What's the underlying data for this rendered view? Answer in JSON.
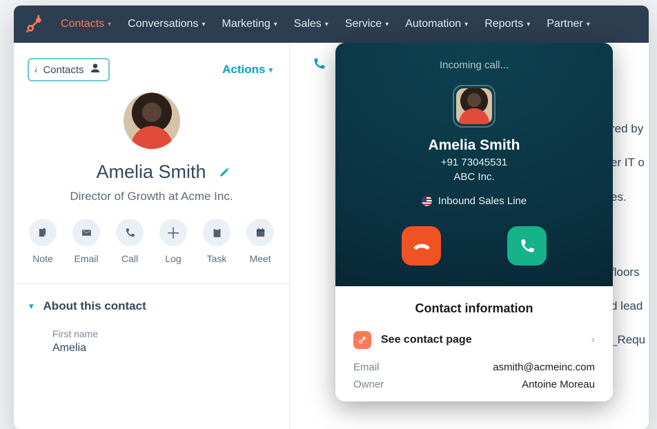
{
  "nav": {
    "items": [
      {
        "label": "Contacts",
        "active": true
      },
      {
        "label": "Conversations"
      },
      {
        "label": "Marketing"
      },
      {
        "label": "Sales"
      },
      {
        "label": "Service"
      },
      {
        "label": "Automation"
      },
      {
        "label": "Reports"
      },
      {
        "label": "Partner"
      }
    ]
  },
  "sidebar": {
    "back_label": "Contacts",
    "actions_label": "Actions",
    "contact_name": "Amelia Smith",
    "contact_title": "Director of Growth at Acme Inc.",
    "actions": [
      {
        "key": "note",
        "label": "Note"
      },
      {
        "key": "email",
        "label": "Email"
      },
      {
        "key": "call",
        "label": "Call"
      },
      {
        "key": "log",
        "label": "Log"
      },
      {
        "key": "task",
        "label": "Task"
      },
      {
        "key": "meet",
        "label": "Meet"
      }
    ],
    "section_title": "About this contact",
    "first_name_label": "First name",
    "first_name_value": "Amelia"
  },
  "call": {
    "status": "Incoming call...",
    "name": "Amelia Smith",
    "number": "+91 73045531",
    "company": "ABC Inc.",
    "line": "Inbound Sales Line",
    "info_title": "Contact information",
    "see_contact": "See contact page",
    "email_label": "Email",
    "email_value": "asmith@acmeinc.com",
    "owner_label": "Owner",
    "owner_value": "Antoine Moreau"
  },
  "bg_fragments": [
    "red by",
    "er IT o",
    "es.",
    "floors",
    "d lead",
    "_Requ"
  ],
  "colors": {
    "brand": "#ff7a59",
    "teal": "#00a4bd",
    "darknav": "#2d3e50",
    "callbg": "#0a3040",
    "decline": "#f05323",
    "accept": "#16b289"
  }
}
